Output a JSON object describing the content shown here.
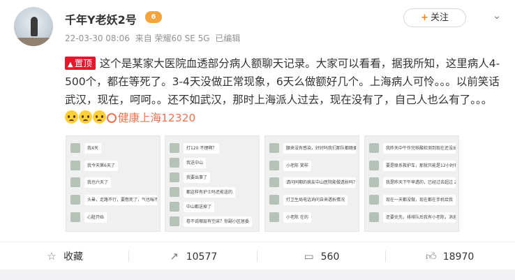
{
  "user": {
    "name": "千年Y老妖2号",
    "vip_badge": "6"
  },
  "meta": {
    "timestamp": "22-03-30 08:06",
    "source": "来自 荣耀60 SE 5G",
    "edited": "已编辑"
  },
  "follow": {
    "label": "关注",
    "plus": "+"
  },
  "post": {
    "pin_label": "置顶",
    "text": "这个是某家大医院血透部分病人额聊天记录。大家可以看看，据我所知，这里病人4-500个，都在等死了。3-4天没做正常现象，6天么做额好几个。上海病人可怜。。。以前笑话武汉，现在，呵呵。。还不如武汉，那时上海派人过去，现在没有了，自己人也么有了。。。",
    "emoji_count": 3,
    "mention": "健康上海12320"
  },
  "thumbnails": [
    {
      "rows": [
        {
          "name": "",
          "text": "我4天",
          "green": false
        },
        {
          "name": "",
          "text": "我今天第6天了",
          "green": false
        },
        {
          "name": "",
          "text": "我也六天了",
          "green": false
        },
        {
          "name": "",
          "text": "头晕，走路不行，要憋死了，气也喘不上来",
          "green": false
        },
        {
          "name": "",
          "text": "心脏开始",
          "green": false
        }
      ]
    },
    {
      "rows": [
        {
          "name": "",
          "text": "打120 不理啊？",
          "green": false
        },
        {
          "name": "",
          "text": "我送中山",
          "green": false
        },
        {
          "name": "",
          "text": "我要出事了",
          "green": false
        },
        {
          "name": "",
          "text": "都这样有护士吗还能送的",
          "green": false
        },
        {
          "name": "",
          "text": "中山都送掉了",
          "green": false
        },
        {
          "name": "",
          "text": "卷不说哪层有空床？你副小区居委",
          "green": false
        }
      ]
    },
    {
      "rows": [
        {
          "name": "",
          "text": "腰来没有感染，好好吗我们那队都随便接，够要透",
          "green": false
        },
        {
          "name": "",
          "text": "小老陈 笑样",
          "green": false
        },
        {
          "name": "",
          "text": "请问同期的病友中山医院能做透析吗？",
          "green": false
        },
        {
          "name": "",
          "text": "打卫生局电话询问自来透析情况",
          "green": false
        },
        {
          "name": "",
          "text": "小老陈 在的",
          "green": false
        }
      ]
    },
    {
      "rows": [
        {
          "name": "",
          "text": "我昨天中午作完核酸检测到现在还没出来，手机上接收不到。",
          "green": false
        },
        {
          "name": "",
          "text": "要是联系救护车，那就只能是12小时有效期",
          "green": false
        },
        {
          "name": "",
          "text": "我是昨天下午早透的，已经过去超过 24小时",
          "green": false
        },
        {
          "name": "",
          "text": "现在一天都没做，现在都在手机给我",
          "green": false
        },
        {
          "name": "",
          "text": "还要优先，排排队后我有小老陈，消息",
          "green": false
        }
      ]
    }
  ],
  "actions": {
    "favorite": "收藏",
    "repost": "10577",
    "comment": "560",
    "like": "18970"
  },
  "icons": {
    "favorite": "star-icon",
    "repost": "share-icon",
    "comment": "comment-icon",
    "like": "thumbs-up-icon",
    "more": "chevron-down-icon"
  }
}
